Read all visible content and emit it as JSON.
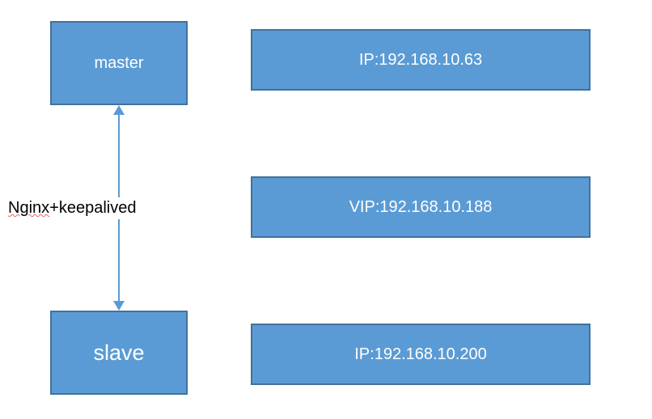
{
  "nodes": {
    "master": {
      "label": "master"
    },
    "slave": {
      "label": "slave"
    },
    "ip1": {
      "label": "IP:192.168.10.63"
    },
    "vip": {
      "label": "VIP:192.168.10.188"
    },
    "ip2": {
      "label": "IP:192.168.10.200"
    }
  },
  "edge": {
    "label_part1": "Nginx",
    "label_part2": "+keepalived"
  },
  "colors": {
    "box_fill": "#5b9bd5",
    "box_border": "#41719c",
    "arrow": "#5b9bd5",
    "underline_wavy": "#e06666"
  }
}
